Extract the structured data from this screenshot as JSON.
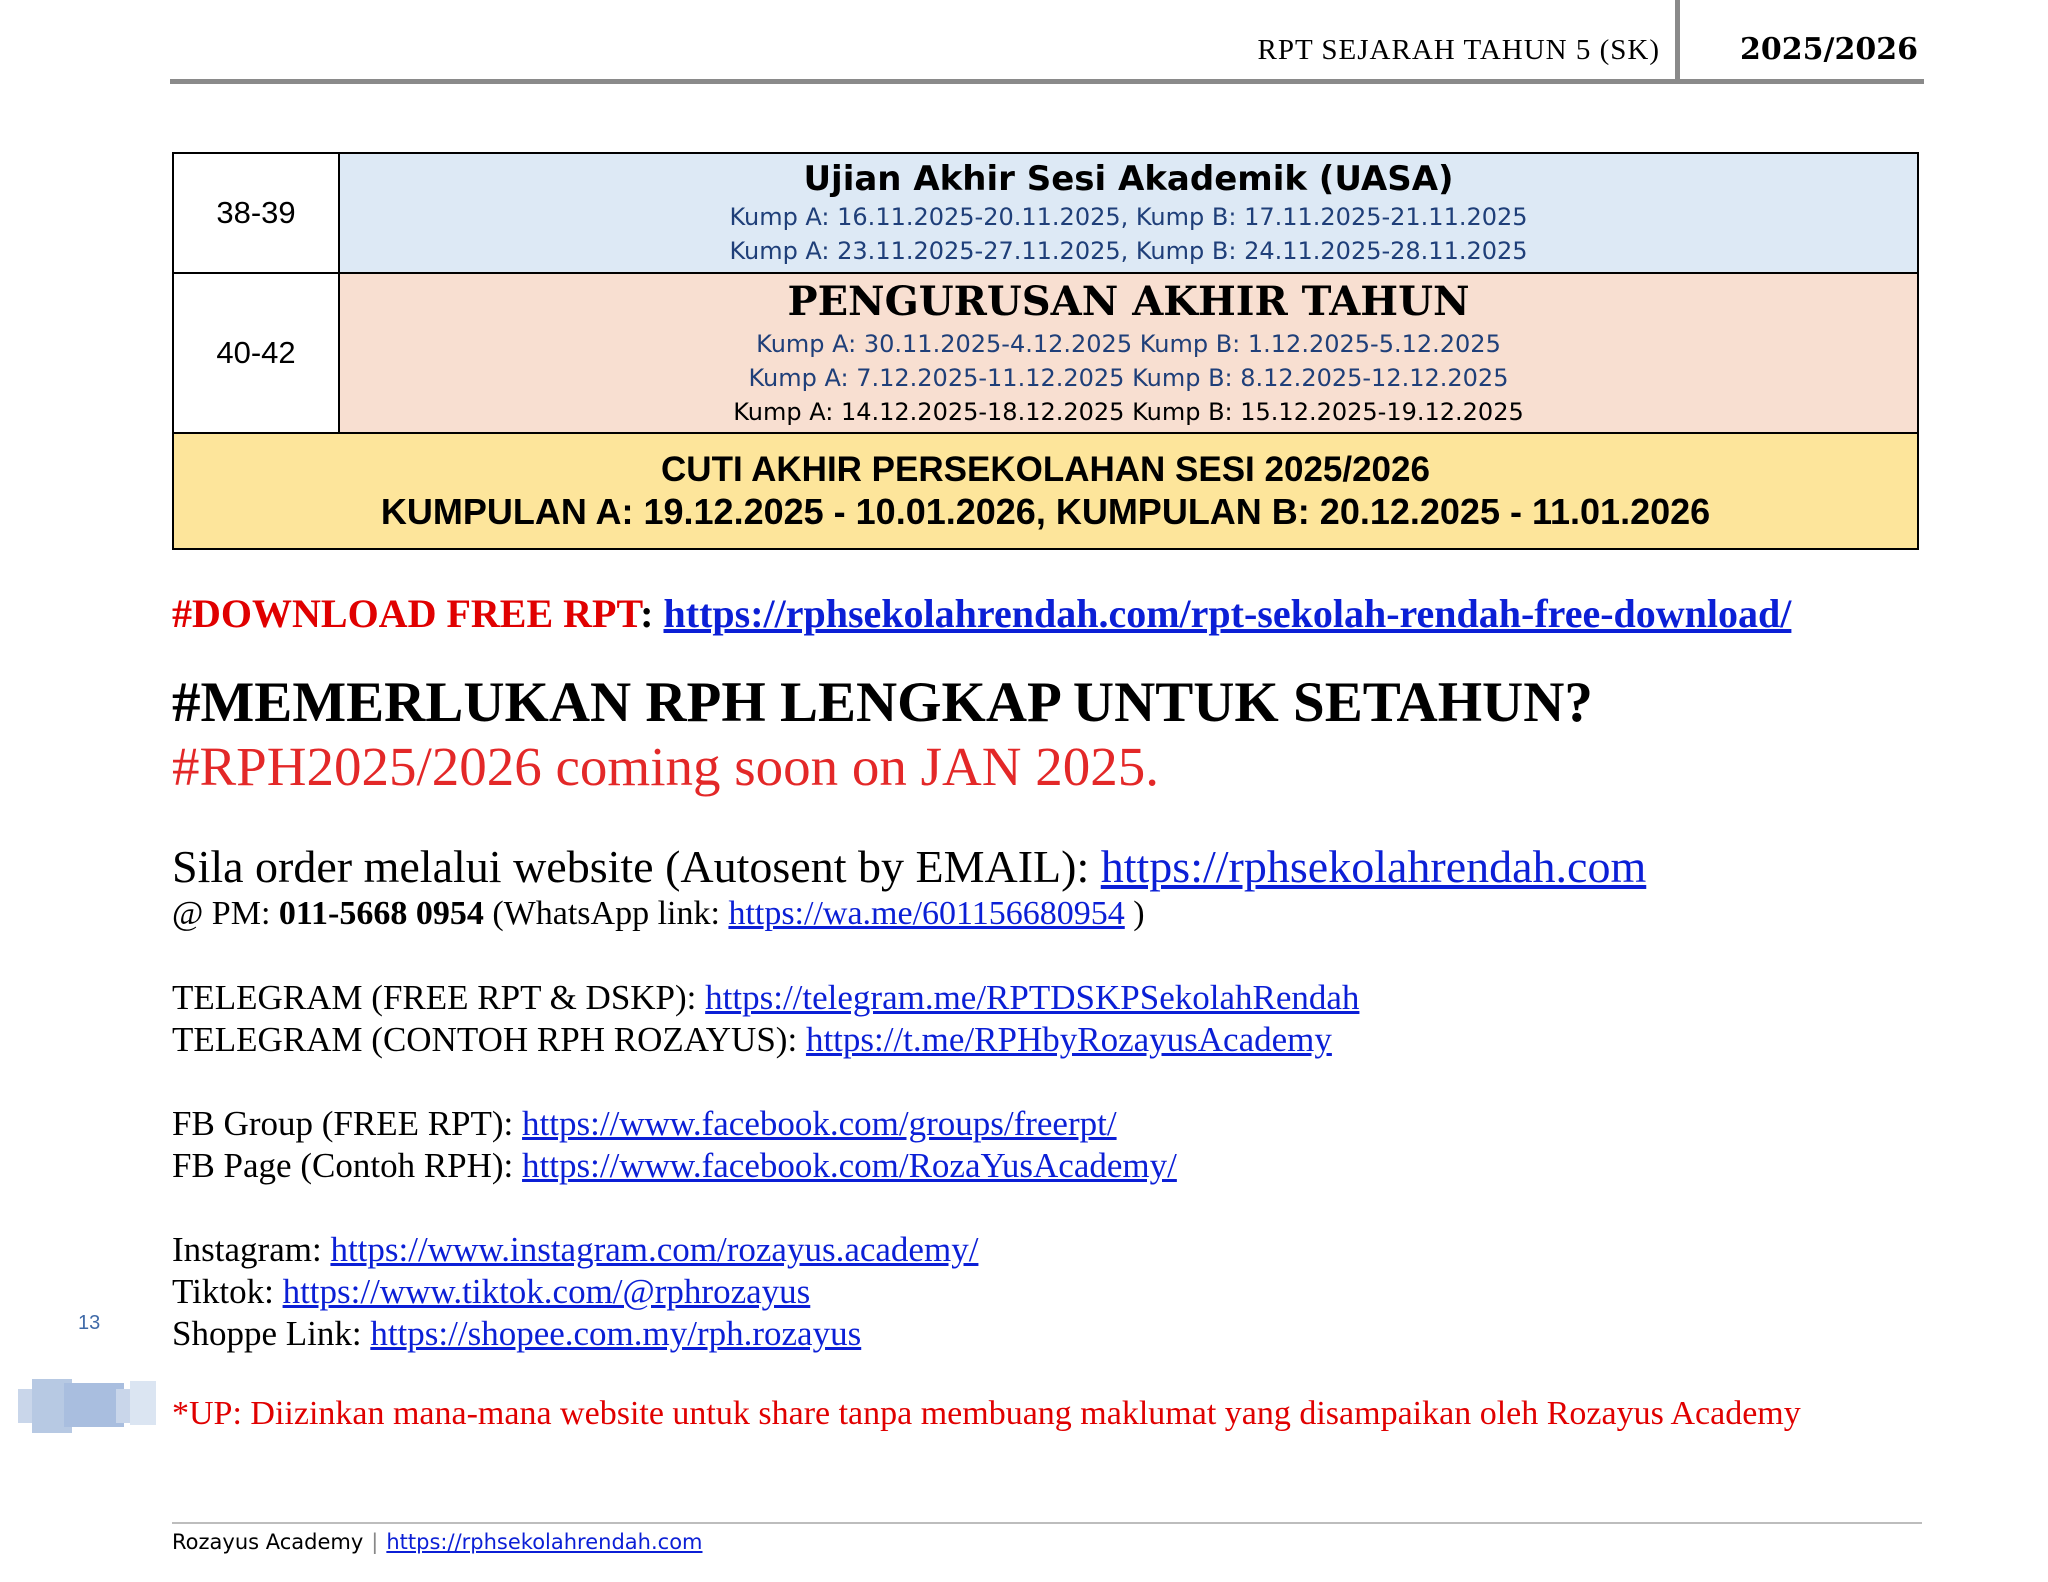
{
  "header": {
    "title": "RPT SEJARAH TAHUN 5 (SK)",
    "year": "2025/2026"
  },
  "table": {
    "row1": {
      "weeks": "38-39",
      "title": "Ujian Akhir Sesi Akademik (UASA)",
      "lines": [
        "Kump A: 16.11.2025-20.11.2025,  Kump B: 17.11.2025-21.11.2025",
        "Kump A: 23.11.2025-27.11.2025,  Kump B: 24.11.2025-28.11.2025"
      ]
    },
    "row2": {
      "weeks": "40-42",
      "title": "PENGURUSAN AKHIR TAHUN",
      "lines": [
        "Kump A: 30.11.2025-4.12.2025 Kump B: 1.12.2025-5.12.2025",
        "Kump A: 7.12.2025-11.12.2025 Kump B: 8.12.2025-12.12.2025",
        "Kump A: 14.12.2025-18.12.2025 Kump B: 15.12.2025-19.12.2025"
      ]
    },
    "row3": {
      "line1": "CUTI AKHIR PERSEKOLAHAN SESI 2025/2026",
      "line2": "KUMPULAN A: 19.12.2025 - 10.01.2026, KUMPULAN B: 20.12.2025 - 11.01.2026"
    }
  },
  "download": {
    "label": "#DOWNLOAD FREE RPT",
    "colon": ":",
    "url": "https://rphsekolahrendah.com/rpt-sekolah-rendah-free-download/"
  },
  "promo": {
    "question": "#MEMERLUKAN RPH LENGKAP UNTUK SETAHUN?",
    "announce": "#RPH2025/2026 coming soon on JAN 2025."
  },
  "order": {
    "label": "Sila order melalui website (Autosent by EMAIL):",
    "url": "https://rphsekolahrendah.com",
    "pm_prefix": "@ PM:",
    "phone": "011-5668 0954",
    "wa_label": "(WhatsApp link:",
    "wa_url": "https://wa.me/601156680954",
    "wa_close": ")"
  },
  "links": {
    "telegram1_label": "TELEGRAM (FREE RPT & DSKP):",
    "telegram1_url": "https://telegram.me/RPTDSKPSekolahRendah",
    "telegram2_label": "TELEGRAM (CONTOH RPH ROZAYUS):",
    "telegram2_url": "https://t.me/RPHbyRozayusAcademy",
    "fbgroup_label": "FB Group (FREE RPT):",
    "fbgroup_url": "https://www.facebook.com/groups/freerpt/",
    "fbpage_label": "FB Page (Contoh RPH):",
    "fbpage_url": "https://www.facebook.com/RozaYusAcademy/",
    "instagram_label": "Instagram:",
    "instagram_url": "https://www.instagram.com/rozayus.academy/",
    "tiktok_label": "Tiktok:",
    "tiktok_url": "https://www.tiktok.com/@rphrozayus",
    "shopee_label": "Shoppe Link:",
    "shopee_url": "https://shopee.com.my/rph.rozayus"
  },
  "note": "*UP: Diizinkan mana-mana website untuk share tanpa membuang maklumat yang disampaikan oleh Rozayus Academy",
  "page_number": "13",
  "footer": {
    "left": "Rozayus Academy",
    "separator": "|",
    "url": "https://rphsekolahrendah.com"
  }
}
